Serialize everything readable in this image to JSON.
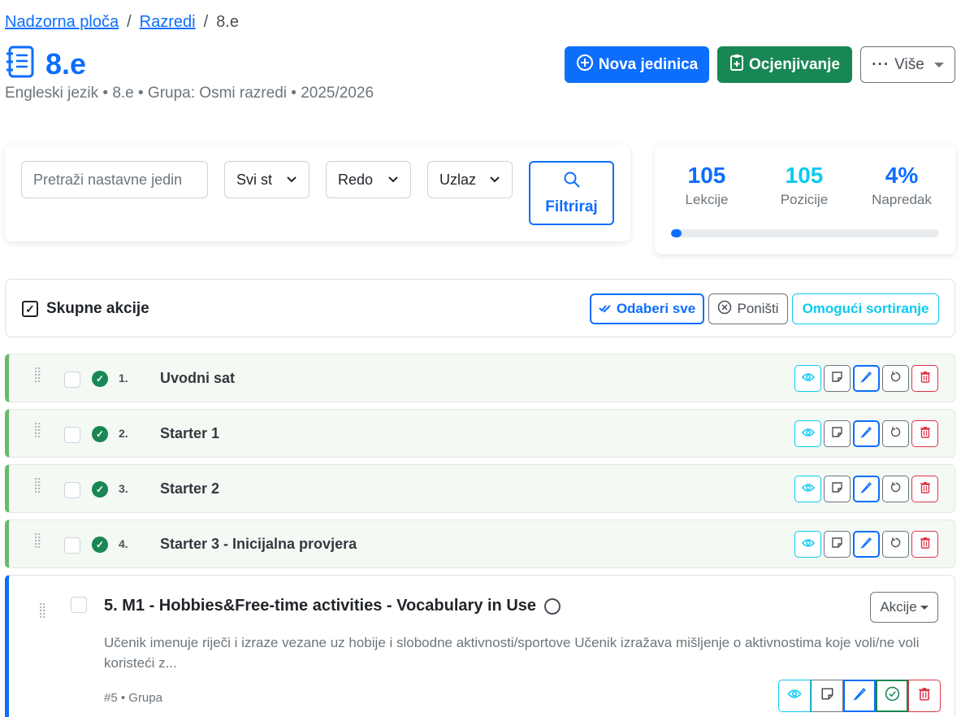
{
  "breadcrumb": {
    "home": "Nadzorna ploča",
    "classes": "Razredi",
    "current": "8.e",
    "sep": "/"
  },
  "page": {
    "title": "8.e",
    "subtitle": "Engleski jezik • 8.e • Grupa: Osmi razredi • 2025/2026"
  },
  "header_buttons": {
    "new_unit": "Nova jedinica",
    "grading": "Ocjenjivanje",
    "more": "Više"
  },
  "filters": {
    "search_placeholder": "Pretraži nastavne jedin",
    "status_value": "Svi st",
    "order_value": "Redo",
    "direction_value": "Uzlaz",
    "filter_button": "Filtriraj"
  },
  "stats": {
    "lessons": {
      "value": "105",
      "label": "Lekcije"
    },
    "positions": {
      "value": "105",
      "label": "Pozicije"
    },
    "progress": {
      "value": "4%",
      "label": "Napredak",
      "fraction": 0.04
    }
  },
  "bulk": {
    "title": "Skupne akcije",
    "select_all": "Odaberi sve",
    "cancel": "Poništi",
    "enable_sort": "Omogući sortiranje"
  },
  "units": [
    {
      "num": "1.",
      "name": "Uvodni sat"
    },
    {
      "num": "2.",
      "name": "Starter 1"
    },
    {
      "num": "3.",
      "name": "Starter 2"
    },
    {
      "num": "4.",
      "name": "Starter 3 - Inicijalna provjera"
    }
  ],
  "open_unit": {
    "title": "5. M1 - Hobbies&Free-time activities - Vocabulary in Use",
    "description": "Učenik imenuje riječi i izraze vezane uz hobije i slobodne aktivnosti/sportove Učenik izražava mišljenje o aktivnostima koje voli/ne voli koristeći z...",
    "meta": "#5 • Grupa",
    "actions_label": "Akcije"
  },
  "colors": {
    "primary": "#0d6efd",
    "success": "#198754",
    "info": "#0dcaf0",
    "danger": "#dc3545"
  }
}
